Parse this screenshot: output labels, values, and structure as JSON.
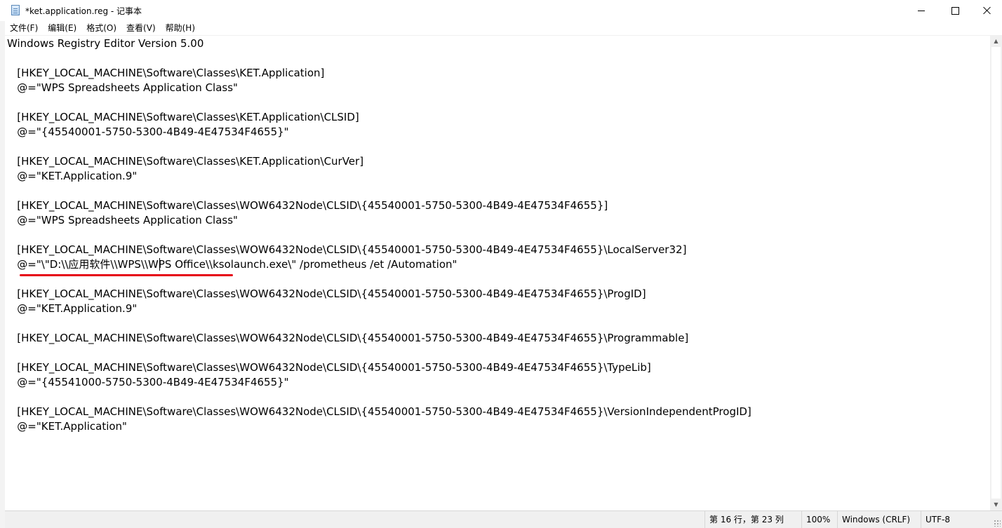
{
  "window": {
    "title": "*ket.application.reg - 记事本",
    "icon": "notepad-icon"
  },
  "caption_buttons": {
    "minimize": "minimize-icon",
    "maximize": "maximize-icon",
    "close": "close-icon"
  },
  "menu": [
    {
      "label": "文件(F)"
    },
    {
      "label": "编辑(E)"
    },
    {
      "label": "格式(O)"
    },
    {
      "label": "查看(V)"
    },
    {
      "label": "帮助(H)"
    }
  ],
  "editor": {
    "lines": [
      "Windows Registry Editor Version 5.00",
      "",
      "   [HKEY_LOCAL_MACHINE\\Software\\Classes\\KET.Application]",
      "   @=\"WPS Spreadsheets Application Class\"",
      "",
      "   [HKEY_LOCAL_MACHINE\\Software\\Classes\\KET.Application\\CLSID]",
      "   @=\"{45540001-5750-5300-4B49-4E47534F4655}\"",
      "",
      "   [HKEY_LOCAL_MACHINE\\Software\\Classes\\KET.Application\\CurVer]",
      "   @=\"KET.Application.9\"",
      "",
      "   [HKEY_LOCAL_MACHINE\\Software\\Classes\\WOW6432Node\\CLSID\\{45540001-5750-5300-4B49-4E47534F4655}]",
      "   @=\"WPS Spreadsheets Application Class\"",
      "",
      "   [HKEY_LOCAL_MACHINE\\Software\\Classes\\WOW6432Node\\CLSID\\{45540001-5750-5300-4B49-4E47534F4655}\\LocalServer32]",
      "   @=\"\\\"D:\\\\应用软件\\\\WPS\\\\WPS Office\\\\ksolaunch.exe\\\" /prometheus /et /Automation\"",
      "",
      "   [HKEY_LOCAL_MACHINE\\Software\\Classes\\WOW6432Node\\CLSID\\{45540001-5750-5300-4B49-4E47534F4655}\\ProgID]",
      "   @=\"KET.Application.9\"",
      "",
      "   [HKEY_LOCAL_MACHINE\\Software\\Classes\\WOW6432Node\\CLSID\\{45540001-5750-5300-4B49-4E47534F4655}\\Programmable]",
      "",
      "   [HKEY_LOCAL_MACHINE\\Software\\Classes\\WOW6432Node\\CLSID\\{45540001-5750-5300-4B49-4E47534F4655}\\TypeLib]",
      "   @=\"{45541000-5750-5300-4B49-4E47534F4655}\"",
      "",
      "   [HKEY_LOCAL_MACHINE\\Software\\Classes\\WOW6432Node\\CLSID\\{45540001-5750-5300-4B49-4E47534F4655}\\VersionIndependentProgID]",
      "   @=\"KET.Application\""
    ],
    "annotation_color": "#e60012"
  },
  "statusbar": {
    "position": "第 16 行，第 23 列",
    "zoom": "100%",
    "line_ending": "Windows (CRLF)",
    "encoding": "UTF-8"
  }
}
